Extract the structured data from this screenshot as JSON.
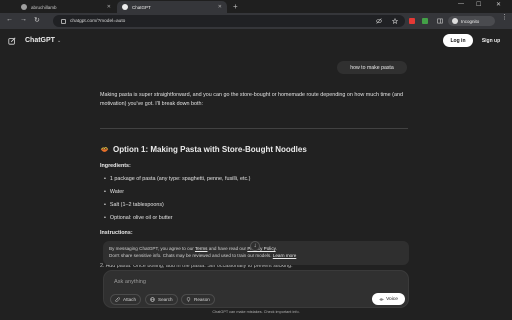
{
  "browser": {
    "tabs": [
      {
        "title": "abruchillamb",
        "active": false
      },
      {
        "title": "ChatGPT",
        "active": true
      }
    ],
    "new_tab_label": "+",
    "url": "chatgpt.com/?model=auto",
    "incognito_label": "Incognito",
    "window_controls": {
      "minimize": "—",
      "maximize": "☐",
      "close": "✕"
    }
  },
  "header": {
    "brand": "ChatGPT",
    "login_label": "Log in",
    "signup_label": "Sign up"
  },
  "conversation": {
    "user_message": "how to make pasta",
    "intro": "Making pasta is super straightforward, and you can go the store-bought or homemade route depending on how much time (and motivation) you've got. I'll break down both:",
    "section_title": "Option 1: Making Pasta with Store-Bought Noodles",
    "ingredients_label": "Ingredients:",
    "ingredients": [
      "1 package of pasta (any type: spaghetti, penne, fusilli, etc.)",
      "Water",
      "Salt (1–2 tablespoons)",
      "Optional: olive oil or butter"
    ],
    "instructions_label": "Instructions:",
    "instruction_peek": "2. Add pasta: Once boiling, add in the pasta. Stir occasionally to prevent sticking."
  },
  "consent": {
    "line1_prefix": "By messaging ChatGPT, you agree to our ",
    "terms_link": "Terms",
    "line1_mid": " and have read our ",
    "privacy_link": "Privacy Policy",
    "line1_suffix": ".",
    "line2_prefix": "Don't share sensitive info. Chats may be reviewed and used to train our models. ",
    "learn_more_link": "Learn more"
  },
  "composer": {
    "placeholder": "Ask anything",
    "attach_label": "Attach",
    "search_label": "Search",
    "reason_label": "Reason",
    "voice_label": "Voice"
  },
  "footer": {
    "disclaimer": "ChatGPT can make mistakes. Check important info."
  },
  "colors": {
    "page_bg": "#212121",
    "bubble_bg": "#303030",
    "accent": "#ffffff"
  }
}
